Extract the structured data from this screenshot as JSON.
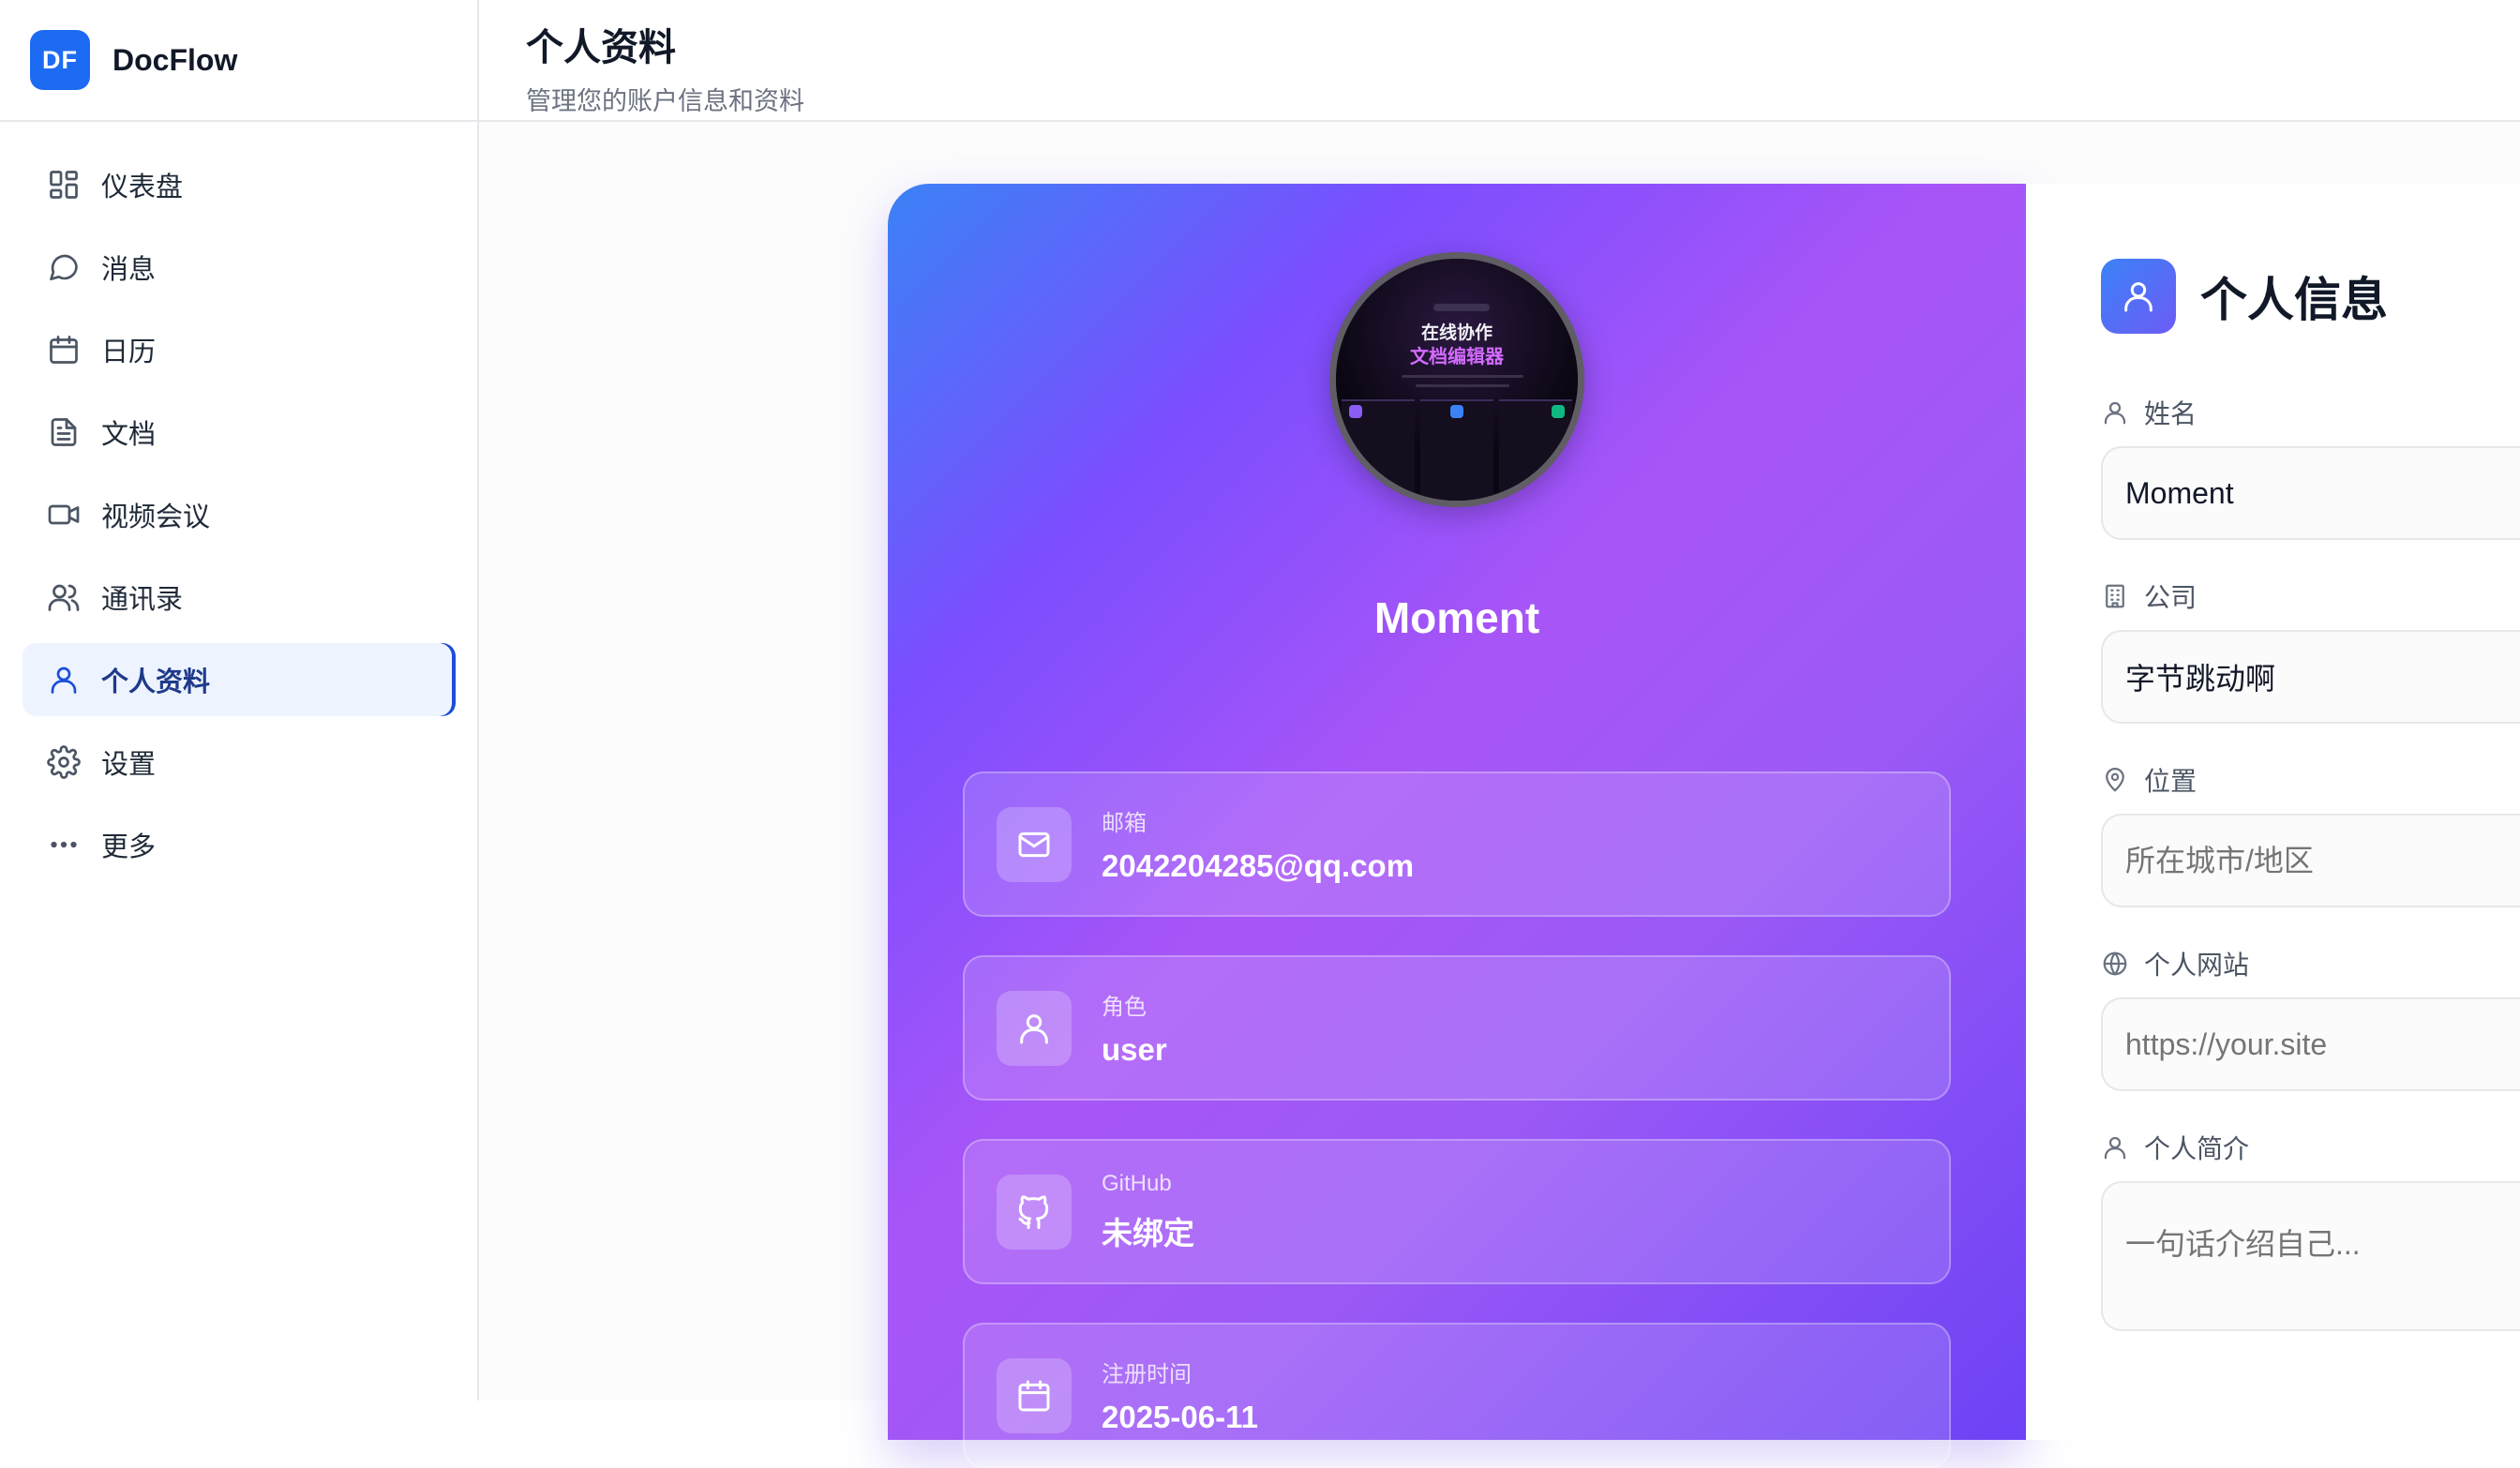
{
  "brand": {
    "logo_text": "DF",
    "name": "DocFlow"
  },
  "sidebar": {
    "items": [
      {
        "label": "仪表盘",
        "icon": "dashboard-icon"
      },
      {
        "label": "消息",
        "icon": "message-icon"
      },
      {
        "label": "日历",
        "icon": "calendar-icon"
      },
      {
        "label": "文档",
        "icon": "document-icon"
      },
      {
        "label": "视频会议",
        "icon": "video-icon"
      },
      {
        "label": "通讯录",
        "icon": "contacts-icon"
      },
      {
        "label": "个人资料",
        "icon": "user-icon",
        "active": true
      },
      {
        "label": "设置",
        "icon": "gear-icon"
      },
      {
        "label": "更多",
        "icon": "more-icon"
      }
    ]
  },
  "header": {
    "title": "个人资料",
    "subtitle": "管理您的账户信息和资料"
  },
  "profile": {
    "avatar": {
      "line1": "在线协作",
      "line2": "文档编辑器"
    },
    "name": "Moment",
    "info": [
      {
        "label": "邮箱",
        "value": "2042204285@qq.com",
        "icon": "mail-icon"
      },
      {
        "label": "角色",
        "value": "user",
        "icon": "user-icon"
      },
      {
        "label": "GitHub",
        "value": "未绑定",
        "icon": "github-icon"
      },
      {
        "label": "注册时间",
        "value": "2025-06-11",
        "icon": "calendar-icon"
      }
    ]
  },
  "form": {
    "title": "个人信息",
    "fields": [
      {
        "label": "姓名",
        "value": "Moment",
        "icon": "user-icon"
      },
      {
        "label": "公司",
        "value": "字节跳动啊",
        "icon": "building-icon"
      },
      {
        "label": "位置",
        "placeholder": "所在城市/地区",
        "icon": "location-icon"
      },
      {
        "label": "个人网站",
        "placeholder": "https://your.site",
        "icon": "globe-icon"
      },
      {
        "label": "个人简介",
        "placeholder": "一句话介绍自己...",
        "icon": "user-icon"
      }
    ]
  },
  "colors": {
    "brand": "#1d6bf3",
    "active_nav_bg": "#eef4ff",
    "card_gradient_start": "#3b82f6",
    "card_gradient_end": "#6d42f5"
  }
}
